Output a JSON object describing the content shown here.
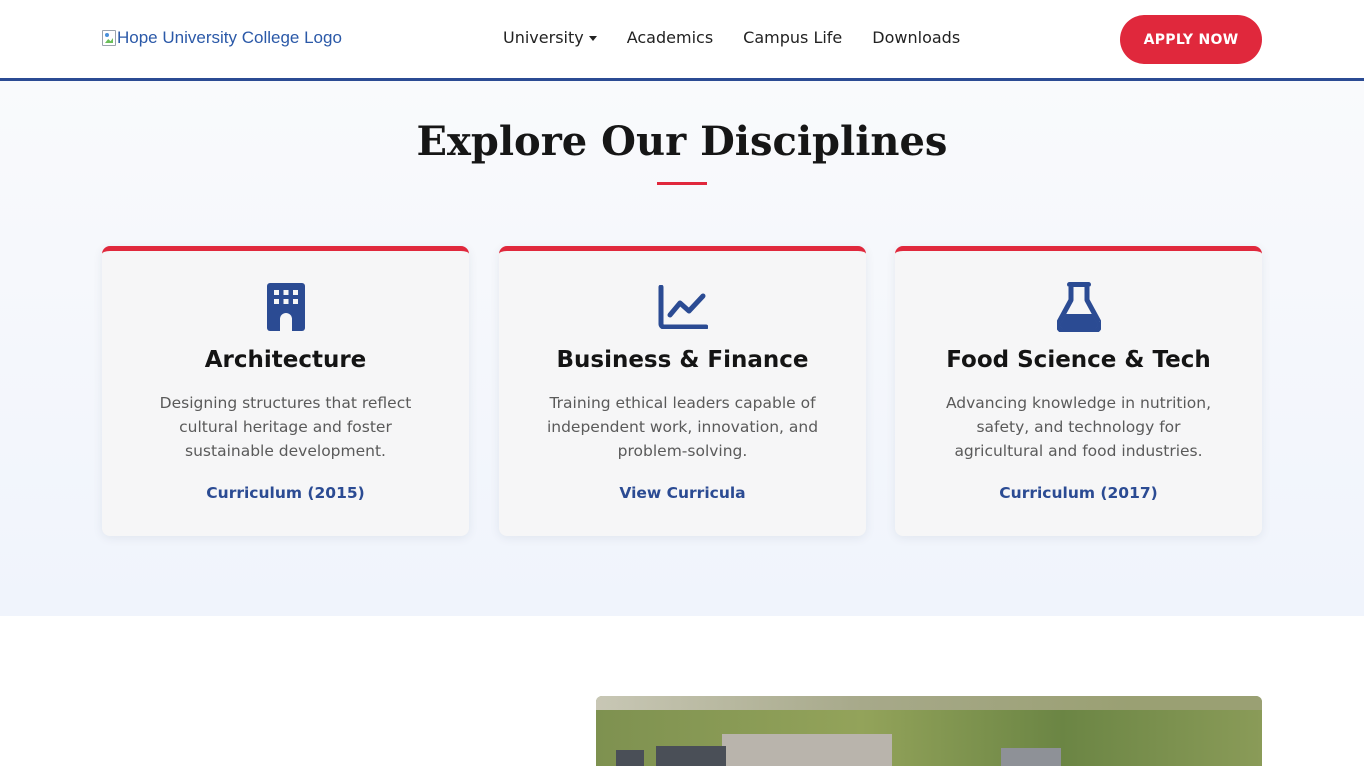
{
  "header": {
    "logo_alt": "Hope University College Logo",
    "nav": [
      {
        "label": "University",
        "has_dropdown": true
      },
      {
        "label": "Academics"
      },
      {
        "label": "Campus Life"
      },
      {
        "label": "Downloads"
      }
    ],
    "apply_label": "APPLY NOW"
  },
  "disciplines": {
    "title": "Explore Our Disciplines",
    "cards": [
      {
        "icon": "building-icon",
        "title": "Architecture",
        "description": "Designing structures that reflect cultural heritage and foster sustainable development.",
        "link": "Curriculum (2015)"
      },
      {
        "icon": "chart-line-icon",
        "title": "Business & Finance",
        "description": "Training ethical leaders capable of independent work, innovation, and problem-solving.",
        "link": "View Curricula"
      },
      {
        "icon": "flask-icon",
        "title": "Food Science & Tech",
        "description": "Advancing knowledge in nutrition, safety, and technology for agricultural and food industries.",
        "link": "Curriculum (2017)"
      }
    ]
  },
  "colors": {
    "accent_red": "#e0283c",
    "brand_blue": "#2b4b93"
  }
}
